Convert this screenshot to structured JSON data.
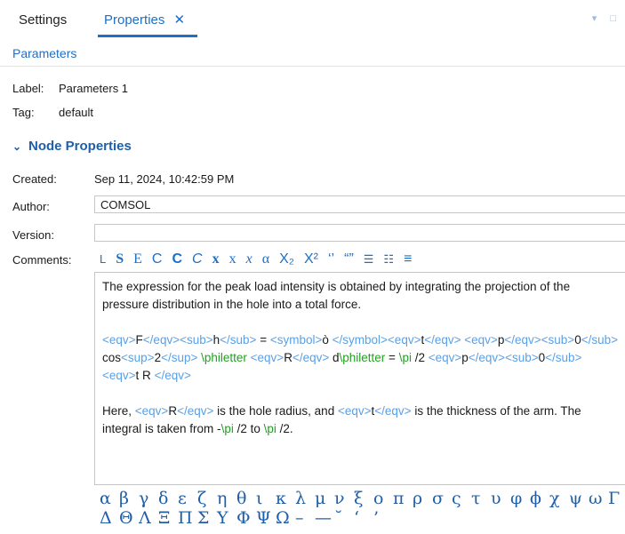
{
  "tabs": {
    "settings": "Settings",
    "properties": "Properties",
    "close_glyph": "✕"
  },
  "window_controls": "▾ □",
  "section": {
    "title": "Parameters"
  },
  "fields": {
    "label_caption": "Label:",
    "label_value": "Parameters 1",
    "tag_caption": "Tag:",
    "tag_value": "default"
  },
  "node_properties": {
    "header": "Node Properties",
    "created_caption": "Created:",
    "created_value": "Sep 11, 2024, 10:42:59 PM",
    "author_caption": "Author:",
    "author_value": "COMSOL",
    "version_caption": "Version:",
    "version_value": "",
    "comments_caption": "Comments:"
  },
  "toolbar": [
    {
      "glyph": "L",
      "name": "plain-text-tool",
      "cls": "small"
    },
    {
      "glyph": "S",
      "name": "bold-serif-tool",
      "cls": "serif bold"
    },
    {
      "glyph": "E",
      "name": "serif-tool",
      "cls": "serif"
    },
    {
      "glyph": "C",
      "name": "sans-c-tool",
      "cls": ""
    },
    {
      "glyph": "C",
      "name": "bold-c-tool",
      "cls": "bold"
    },
    {
      "glyph": "C",
      "name": "italic-c-tool",
      "cls": "ital"
    },
    {
      "glyph": "x",
      "name": "bold-x-tool",
      "cls": "serif bold"
    },
    {
      "glyph": "x",
      "name": "serif-x-tool",
      "cls": "serif"
    },
    {
      "glyph": "x",
      "name": "italic-x-tool",
      "cls": "serif ital"
    },
    {
      "glyph": "α",
      "name": "greek-tool",
      "cls": "serif"
    },
    {
      "glyph": "X₂",
      "name": "subscript-tool",
      "cls": ""
    },
    {
      "glyph": "X²",
      "name": "superscript-tool",
      "cls": ""
    },
    {
      "glyph": "‘’",
      "name": "single-quote-tool",
      "cls": ""
    },
    {
      "glyph": "“”",
      "name": "double-quote-tool",
      "cls": ""
    },
    {
      "glyph": "☰",
      "name": "bullet-list-icon",
      "cls": "small"
    },
    {
      "glyph": "☷",
      "name": "numbered-list-icon",
      "cls": "small"
    },
    {
      "glyph": "≡",
      "name": "indent-list-icon",
      "cls": ""
    }
  ],
  "editor": {
    "para1": "The expression for the peak load intensity is obtained by integrating the projection of the pressure distribution in the hole into a total force.",
    "para2": [
      {
        "t": "<eqv>",
        "c": "eq"
      },
      {
        "t": "F",
        "c": "bk"
      },
      {
        "t": "</eqv>",
        "c": "eq"
      },
      {
        "t": "<sub>",
        "c": "eq"
      },
      {
        "t": "h",
        "c": "bk"
      },
      {
        "t": "</sub>",
        "c": "eq"
      },
      {
        "t": " = ",
        "c": "bk"
      },
      {
        "t": "<symbol>",
        "c": "eq"
      },
      {
        "t": "ò ",
        "c": "bk"
      },
      {
        "t": "</symbol>",
        "c": "eq"
      },
      {
        "t": "<eqv>",
        "c": "eq"
      },
      {
        "t": "t",
        "c": "bk"
      },
      {
        "t": "</eqv> ",
        "c": "eq"
      },
      {
        "t": "<eqv>",
        "c": "eq"
      },
      {
        "t": "p",
        "c": "bk"
      },
      {
        "t": "</eqv>",
        "c": "eq"
      },
      {
        "t": "<sub>",
        "c": "eq"
      },
      {
        "t": "0",
        "c": "bk"
      },
      {
        "t": "</sub> ",
        "c": "eq"
      },
      {
        "t": "cos",
        "c": "bk"
      },
      {
        "t": "<sup>",
        "c": "eq"
      },
      {
        "t": "2",
        "c": "bk"
      },
      {
        "t": "</sup> ",
        "c": "eq"
      },
      {
        "t": "\\philetter ",
        "c": "gr"
      },
      {
        "t": "<eqv>",
        "c": "eq"
      },
      {
        "t": "R",
        "c": "bk"
      },
      {
        "t": "</eqv> ",
        "c": "eq"
      },
      {
        "t": "d",
        "c": "bk"
      },
      {
        "t": "\\philetter",
        "c": "gr"
      },
      {
        "t": " = ",
        "c": "bk"
      },
      {
        "t": "\\pi",
        "c": "gr"
      },
      {
        "t": " /2 ",
        "c": "bk"
      },
      {
        "t": "<eqv>",
        "c": "eq"
      },
      {
        "t": "p",
        "c": "bk"
      },
      {
        "t": "</eqv>",
        "c": "eq"
      },
      {
        "t": "<sub>",
        "c": "eq"
      },
      {
        "t": "0",
        "c": "bk"
      },
      {
        "t": "</sub> ",
        "c": "eq"
      },
      {
        "t": "<eqv>",
        "c": "eq"
      },
      {
        "t": "t R ",
        "c": "bk"
      },
      {
        "t": "</eqv>",
        "c": "eq"
      }
    ],
    "para3": [
      {
        "t": "Here, ",
        "c": "bk"
      },
      {
        "t": "<eqv>",
        "c": "eq"
      },
      {
        "t": "R",
        "c": "bk"
      },
      {
        "t": "</eqv>",
        "c": "eq"
      },
      {
        "t": " is the hole radius, and ",
        "c": "bk"
      },
      {
        "t": "<eqv>",
        "c": "eq"
      },
      {
        "t": "t",
        "c": "bk"
      },
      {
        "t": "</eqv>",
        "c": "eq"
      },
      {
        "t": " is the thickness of the arm. The integral is taken from -",
        "c": "bk"
      },
      {
        "t": "\\pi",
        "c": "gr"
      },
      {
        "t": " /2 to ",
        "c": "bk"
      },
      {
        "t": "\\pi",
        "c": "gr"
      },
      {
        "t": " /2.",
        "c": "bk"
      }
    ]
  },
  "greek_palette": [
    "α",
    "β",
    "γ",
    "δ",
    "ε",
    "ζ",
    "η",
    "θ",
    "ι",
    "κ",
    "λ",
    "μ",
    "ν",
    "ξ",
    "ο",
    "π",
    "ρ",
    "σ",
    "ς",
    "τ",
    "υ",
    "φ",
    "ϕ",
    "χ",
    "ψ",
    "ω",
    "Γ",
    "Δ",
    "Θ",
    "Λ",
    "Ξ",
    "Π",
    "Σ",
    "Υ",
    "Φ",
    "Ψ",
    "Ω",
    "–",
    "—",
    "˘",
    "‘",
    "’"
  ]
}
